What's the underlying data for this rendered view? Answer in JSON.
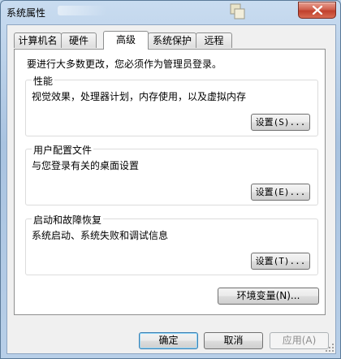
{
  "window": {
    "title": "系统属性"
  },
  "tabs": [
    {
      "label": "计算机名"
    },
    {
      "label": "硬件"
    },
    {
      "label": "高级"
    },
    {
      "label": "系统保护"
    },
    {
      "label": "远程"
    }
  ],
  "active_tab": "高级",
  "intro": "要进行大多数更改，您必须作为管理员登录。",
  "groups": {
    "performance": {
      "title": "性能",
      "desc": "视觉效果，处理器计划，内存使用，以及虚拟内存",
      "button": "设置(S)..."
    },
    "profiles": {
      "title": "用户配置文件",
      "desc": "与您登录有关的桌面设置",
      "button": "设置(E)..."
    },
    "startup": {
      "title": "启动和故障恢复",
      "desc": "系统启动、系统失败和调试信息",
      "button": "设置(T)..."
    }
  },
  "env_button": "环境变量(N)...",
  "footer": {
    "ok": "确定",
    "cancel": "取消",
    "apply": "应用(A)"
  }
}
